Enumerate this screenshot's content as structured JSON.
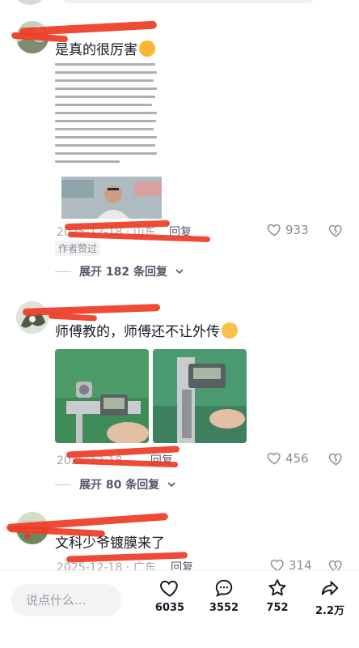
{
  "comments": [
    {
      "text": "是真的很厉害",
      "emoji": "thumbs-up",
      "meta": "2025-12-18 · 山东",
      "reply": "回复",
      "likes": "933",
      "author_badge": "作者赞过",
      "expand": "展开 182 条回复"
    },
    {
      "text": "师傅教的，师傅还不让外传",
      "emoji": "wink",
      "meta": "2025-12-18",
      "reply": "回复",
      "likes": "456",
      "expand": "展开 80 条回复"
    },
    {
      "text": "文科少爷镀膜来了",
      "meta": "2025-12-18 · 广东",
      "reply": "回复",
      "likes": "314"
    }
  ],
  "bottom_bar": {
    "input_placeholder": "说点什么...",
    "like_count": "6035",
    "comment_count": "3552",
    "favorite_count": "752",
    "share_count": "2.2万"
  },
  "colors": {
    "redaction": "#ee3b24",
    "meta_gray": "#a8a8ab",
    "text": "#161823"
  }
}
